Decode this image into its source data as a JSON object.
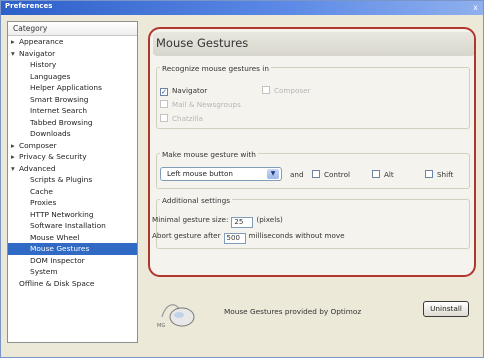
{
  "window": {
    "title": "Preferences",
    "close_glyph": "x"
  },
  "sidebar": {
    "header": "Category",
    "items": [
      {
        "label": "Appearance",
        "level": 0,
        "twisty": "▸"
      },
      {
        "label": "Navigator",
        "level": 0,
        "twisty": "▾"
      },
      {
        "label": "History",
        "level": 1
      },
      {
        "label": "Languages",
        "level": 1
      },
      {
        "label": "Helper Applications",
        "level": 1
      },
      {
        "label": "Smart Browsing",
        "level": 1
      },
      {
        "label": "Internet Search",
        "level": 1
      },
      {
        "label": "Tabbed Browsing",
        "level": 1
      },
      {
        "label": "Downloads",
        "level": 1
      },
      {
        "label": "Composer",
        "level": 0,
        "twisty": "▸"
      },
      {
        "label": "Privacy & Security",
        "level": 0,
        "twisty": "▸"
      },
      {
        "label": "Advanced",
        "level": 0,
        "twisty": "▾"
      },
      {
        "label": "Scripts & Plugins",
        "level": 1
      },
      {
        "label": "Cache",
        "level": 1
      },
      {
        "label": "Proxies",
        "level": 1
      },
      {
        "label": "HTTP Networking",
        "level": 1
      },
      {
        "label": "Software Installation",
        "level": 1
      },
      {
        "label": "Mouse Wheel",
        "level": 1
      },
      {
        "label": "Mouse Gestures",
        "level": 1,
        "selected": true
      },
      {
        "label": "DOM Inspector",
        "level": 1
      },
      {
        "label": "System",
        "level": 1
      },
      {
        "label": "Offline & Disk Space",
        "level": 0
      }
    ]
  },
  "panel": {
    "title": "Mouse Gestures",
    "recognize": {
      "legend": "Recognize mouse gestures in",
      "options": [
        {
          "label": "Navigator",
          "checked": true,
          "disabled": false
        },
        {
          "label": "Mail & Newsgroups",
          "checked": false,
          "disabled": true
        },
        {
          "label": "Chatzilla",
          "checked": false,
          "disabled": true
        },
        {
          "label": "Composer",
          "checked": false,
          "disabled": true
        }
      ]
    },
    "make": {
      "legend": "Make mouse gesture with",
      "button_value": "Left mouse button",
      "and_label": "and",
      "control_label": "Control",
      "alt_label": "Alt",
      "shift_label": "Shift"
    },
    "additional": {
      "legend": "Additional settings",
      "min_size_label": "Minimal gesture size:",
      "min_size_value": "25",
      "min_size_unit": "(pixels)",
      "abort_label": "Abort gesture after",
      "abort_value": "500",
      "abort_unit": "milliseconds without move"
    }
  },
  "footer": {
    "text": "Mouse Gestures provided by Optimoz",
    "uninstall_label": "Uninstall",
    "logo_icon": "mouse-logo-icon"
  }
}
